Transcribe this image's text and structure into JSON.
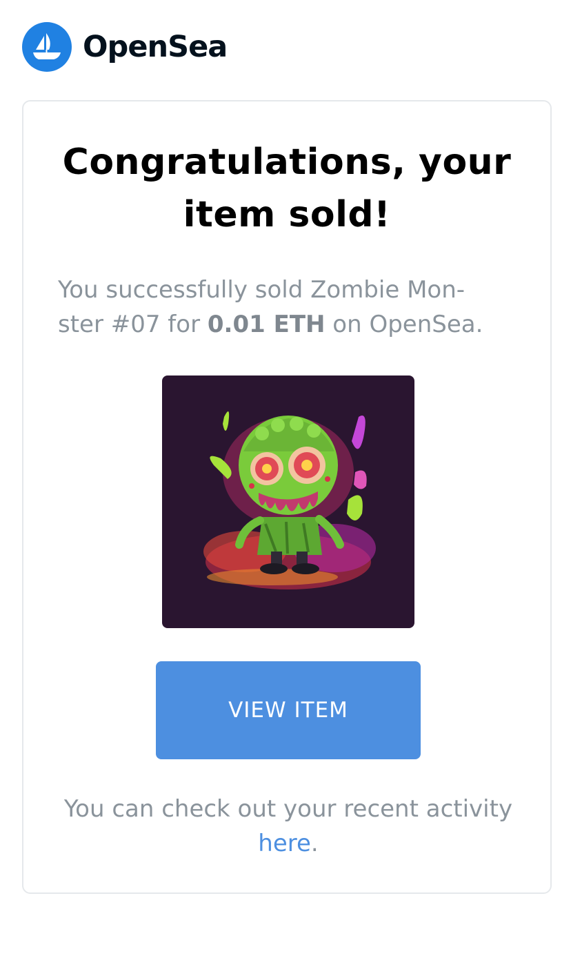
{
  "header": {
    "brand_name": "OpenSea",
    "logo_icon": "opensea-ship-logo",
    "brand_color": "#2081e2"
  },
  "card": {
    "title": "Congratulations, your item sold!",
    "message_prefix": "You successfully sold Zombie Mon-ster #07 for ",
    "sale_price": "0.01 ETH",
    "message_suffix": " on OpenSea.",
    "item_name": "Zombie Mon-ster #07",
    "image_description": "zombie-monster-nft-artwork",
    "view_button_label": "VIEW ITEM",
    "activity_prefix": "You can check out your recent activity ",
    "activity_link": "here",
    "activity_suffix": "."
  },
  "colors": {
    "button": "#4d8fe0",
    "link": "#4d8fe0",
    "muted_text": "#8a939b",
    "card_border": "#e5e8eb"
  }
}
